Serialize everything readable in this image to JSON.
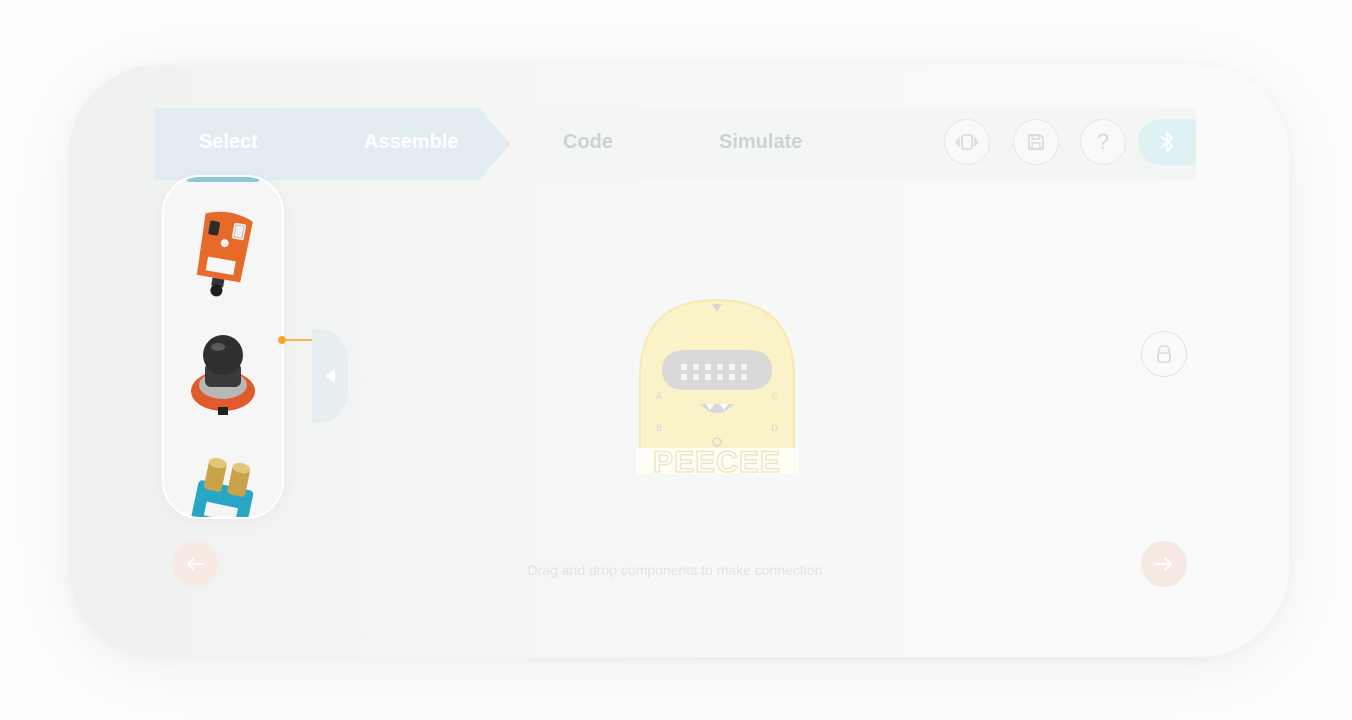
{
  "steps": [
    {
      "label": "Select",
      "state": "done"
    },
    {
      "label": "Assemble",
      "state": "done"
    },
    {
      "label": "Code",
      "state": "todo"
    },
    {
      "label": "Simulate",
      "state": "todo"
    }
  ],
  "toolbar": [
    {
      "icon": "vibration-icon"
    },
    {
      "icon": "save-icon"
    },
    {
      "icon": "help-icon",
      "label": "?"
    },
    {
      "icon": "bluetooth-icon"
    }
  ],
  "components": [
    {
      "name": "ir-sensor-module",
      "color": "#e66b2a"
    },
    {
      "name": "joystick-module",
      "color": "#e05a2b"
    },
    {
      "name": "ultrasonic-sensor-module",
      "color": "#29a6c5"
    }
  ],
  "board": {
    "name": "quarky",
    "pins": [
      "A",
      "B",
      "C",
      "D"
    ],
    "brand_text": "PEECEE",
    "color": "#fbf3c8"
  },
  "hint": "Drag and drop components to make connection",
  "colors": {
    "accent_blue": "#e3edf1",
    "accent_orange": "#f5a623",
    "nav_button": "#f8e9e2"
  }
}
